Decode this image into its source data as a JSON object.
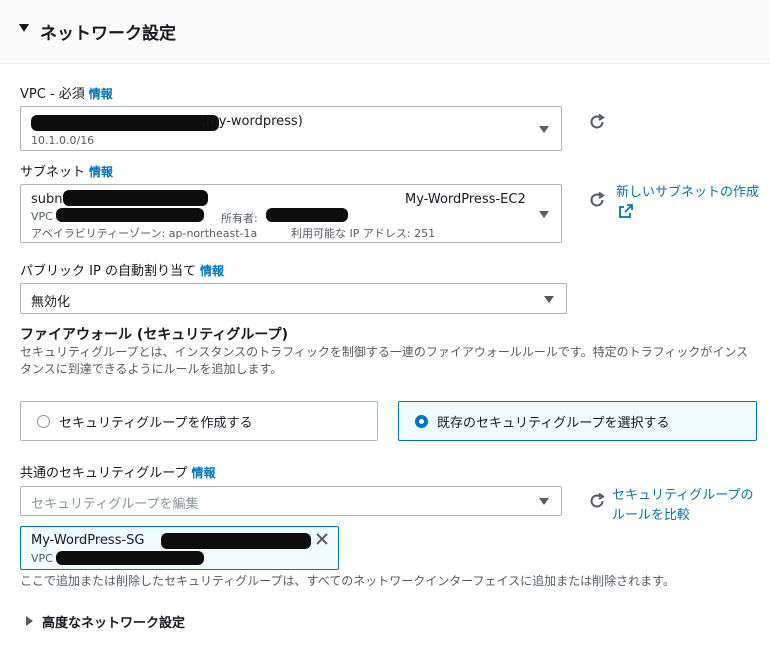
{
  "section": {
    "title": "ネットワーク設定"
  },
  "vpc": {
    "label": "VPC - 必須",
    "info": "情報",
    "selected_name": "(my-wordpress)",
    "cidr": "10.1.0.0/16"
  },
  "subnet": {
    "label": "サブネット",
    "info": "情報",
    "id_prefix": "subnet",
    "name": "My-WordPress-EC2",
    "vpc_prefix": "VPC",
    "owner_label": "所有者:",
    "az": "アベイラビリティーゾーン: ap-northeast-1a",
    "available_ip": "利用可能な IP アドレス: 251",
    "create_link": "新しいサブネットの作成"
  },
  "public_ip": {
    "label": "パブリック IP の自動割り当て",
    "info": "情報",
    "value": "無効化"
  },
  "firewall": {
    "title": "ファイアウォール (セキュリティグループ)",
    "description": "セキュリティグループとは、インスタンスのトラフィックを制御する一連のファイアウォールルールです。特定のトラフィックがインスタンスに到達できるようにルールを追加します。",
    "option_create": "セキュリティグループを作成する",
    "option_existing": "既存のセキュリティグループを選択する",
    "selected_option": "existing"
  },
  "common_sg": {
    "label": "共通のセキュリティグループ",
    "info": "情報",
    "placeholder": "セキュリティグループを編集",
    "compare_link": "セキュリティグループのルールを比較",
    "token_name": "My-WordPress-SG",
    "token_vpc_prefix": "VPC",
    "note": "ここで追加または削除したセキュリティグループは、すべてのネットワークインターフェイスに追加または削除されます。"
  },
  "advanced": {
    "title": "高度なネットワーク設定"
  },
  "colors": {
    "accent": "#0073bb",
    "text": "#16191f",
    "muted": "#545b64",
    "border": "#aab7b8"
  }
}
